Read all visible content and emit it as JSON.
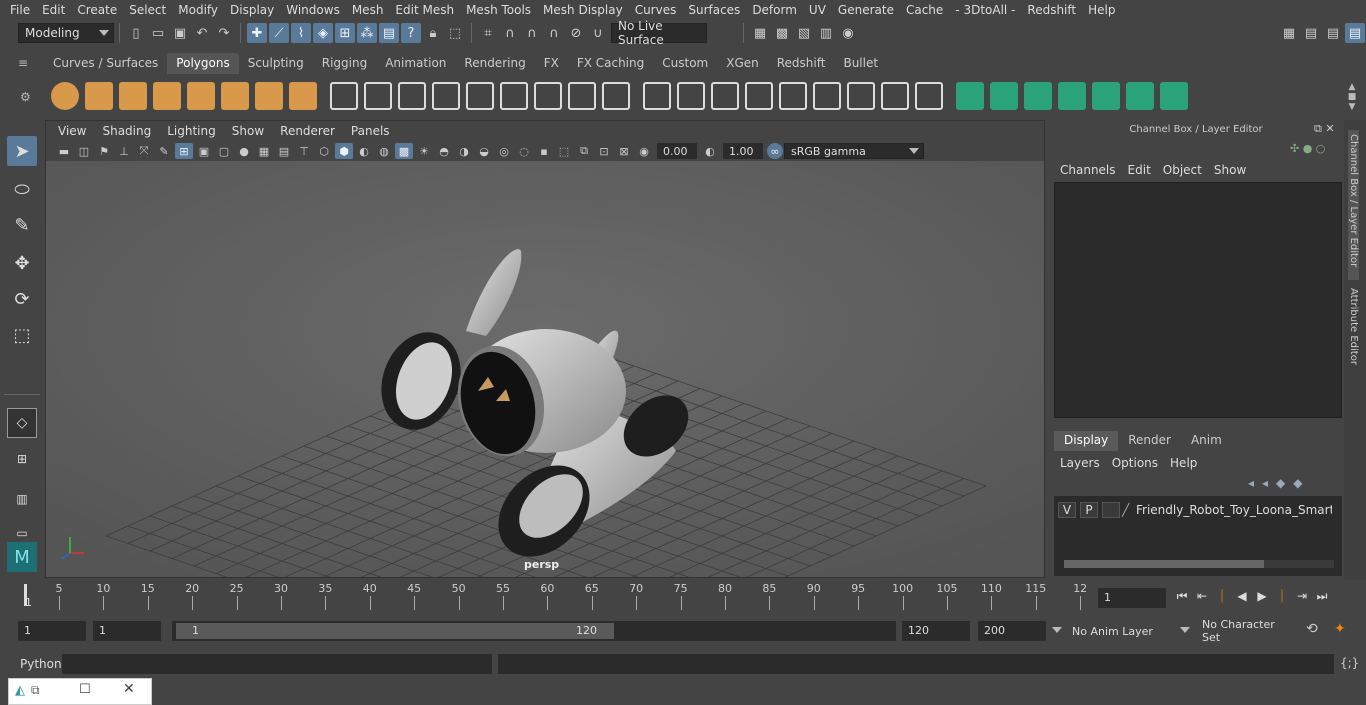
{
  "menubar": [
    "File",
    "Edit",
    "Create",
    "Select",
    "Modify",
    "Display",
    "Windows",
    "Mesh",
    "Edit Mesh",
    "Mesh Tools",
    "Mesh Display",
    "Curves",
    "Surfaces",
    "Deform",
    "UV",
    "Generate",
    "Cache",
    "- 3DtoAll -",
    "Redshift",
    "Help"
  ],
  "status": {
    "workspace": "Modeling",
    "live_surface": "No Live Surface"
  },
  "shelf_tabs": [
    "Curves / Surfaces",
    "Polygons",
    "Sculpting",
    "Rigging",
    "Animation",
    "Rendering",
    "FX",
    "FX Caching",
    "Custom",
    "XGen",
    "Redshift",
    "Bullet"
  ],
  "shelf_active": "Polygons",
  "viewport": {
    "menu": [
      "View",
      "Shading",
      "Lighting",
      "Show",
      "Renderer",
      "Panels"
    ],
    "exposure": "0.00",
    "gamma": "1.00",
    "colorspace": "sRGB gamma",
    "camera_label": "persp"
  },
  "channel_box": {
    "title": "Channel Box / Layer Editor",
    "menu": [
      "Channels",
      "Edit",
      "Object",
      "Show"
    ],
    "tabs": [
      "Display",
      "Render",
      "Anim"
    ],
    "active_tab": "Display",
    "layer_menu": [
      "Layers",
      "Options",
      "Help"
    ],
    "layer": {
      "v": "V",
      "p": "P",
      "name": "Friendly_Robot_Toy_Loona_Smart_Pet"
    }
  },
  "side_tabs": {
    "tab1": "Channel Box / Layer Editor",
    "tab2": "Attribute Editor"
  },
  "timeline": {
    "ticks": [
      "5",
      "10",
      "15",
      "20",
      "25",
      "30",
      "35",
      "40",
      "45",
      "50",
      "55",
      "60",
      "65",
      "70",
      "75",
      "80",
      "85",
      "90",
      "95",
      "100",
      "105",
      "110",
      "115",
      "12"
    ],
    "start_label": "1",
    "current_frame": "1"
  },
  "range": {
    "start": "1",
    "playback_start": "1",
    "slider_start": "1",
    "slider_end": "120",
    "playback_end": "120",
    "end": "200",
    "anim_layer": "No Anim Layer",
    "char_set": "No Character Set"
  },
  "cmdline": {
    "label": "Python"
  }
}
